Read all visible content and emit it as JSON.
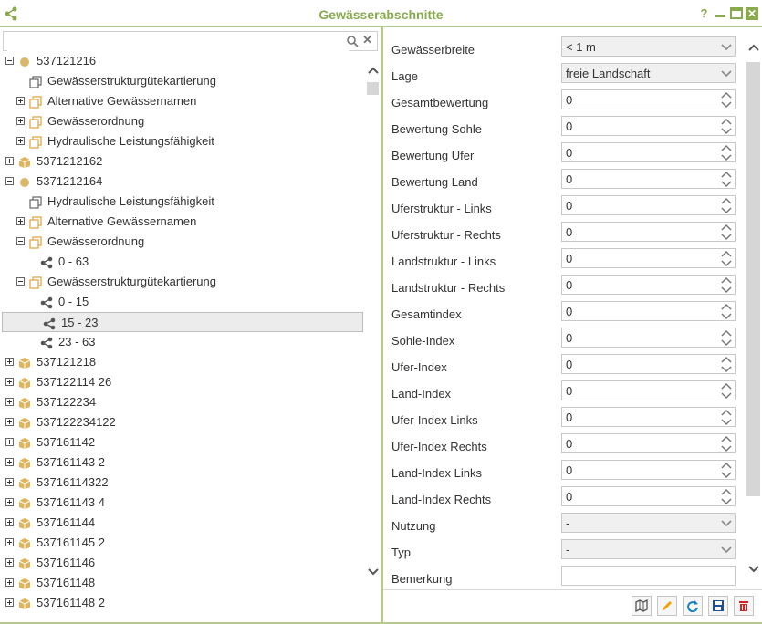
{
  "window": {
    "title": "Gewässerabschnitte",
    "help": "?",
    "accent": "#8aaa4e"
  },
  "search": {
    "value": "",
    "placeholder": ""
  },
  "tree": [
    {
      "label": "537121216",
      "depth": 0,
      "expander": "minus",
      "icon": "circle"
    },
    {
      "label": "Gewässerstrukturgütekartierung",
      "depth": 1,
      "expander": "none",
      "icon": "layers-outline"
    },
    {
      "label": "Alternative Gewässernamen",
      "depth": 1,
      "expander": "plus",
      "icon": "layers"
    },
    {
      "label": "Gewässerordnung",
      "depth": 1,
      "expander": "plus",
      "icon": "layers"
    },
    {
      "label": "Hydraulische Leistungsfähigkeit",
      "depth": 1,
      "expander": "plus",
      "icon": "layers"
    },
    {
      "label": "5371212162",
      "depth": 0,
      "expander": "plus",
      "icon": "box"
    },
    {
      "label": "5371212164",
      "depth": 0,
      "expander": "minus",
      "icon": "circle"
    },
    {
      "label": "Hydraulische Leistungsfähigkeit",
      "depth": 1,
      "expander": "none",
      "icon": "layers-outline"
    },
    {
      "label": "Alternative Gewässernamen",
      "depth": 1,
      "expander": "plus",
      "icon": "layers"
    },
    {
      "label": "Gewässerordnung",
      "depth": 1,
      "expander": "minus",
      "icon": "layers"
    },
    {
      "label": "0 - 63",
      "depth": 2,
      "expander": "none",
      "icon": "share"
    },
    {
      "label": "Gewässerstrukturgütekartierung",
      "depth": 1,
      "expander": "minus",
      "icon": "layers"
    },
    {
      "label": "0 - 15",
      "depth": 2,
      "expander": "none",
      "icon": "share"
    },
    {
      "label": "15 - 23",
      "depth": 2,
      "expander": "none",
      "icon": "share",
      "selected": true
    },
    {
      "label": "23 - 63",
      "depth": 2,
      "expander": "none",
      "icon": "share"
    },
    {
      "label": "537121218",
      "depth": 0,
      "expander": "plus",
      "icon": "box"
    },
    {
      "label": "537122114 26",
      "depth": 0,
      "expander": "plus",
      "icon": "box"
    },
    {
      "label": "537122234",
      "depth": 0,
      "expander": "plus",
      "icon": "box"
    },
    {
      "label": "537122234122",
      "depth": 0,
      "expander": "plus",
      "icon": "box"
    },
    {
      "label": "537161142",
      "depth": 0,
      "expander": "plus",
      "icon": "box"
    },
    {
      "label": "537161143 2",
      "depth": 0,
      "expander": "plus",
      "icon": "box"
    },
    {
      "label": "53716114322",
      "depth": 0,
      "expander": "plus",
      "icon": "box"
    },
    {
      "label": "537161143 4",
      "depth": 0,
      "expander": "plus",
      "icon": "box"
    },
    {
      "label": "537161144",
      "depth": 0,
      "expander": "plus",
      "icon": "box"
    },
    {
      "label": "537161145 2",
      "depth": 0,
      "expander": "plus",
      "icon": "box"
    },
    {
      "label": "537161146",
      "depth": 0,
      "expander": "plus",
      "icon": "box"
    },
    {
      "label": "537161148",
      "depth": 0,
      "expander": "plus",
      "icon": "box"
    },
    {
      "label": "537161148 2",
      "depth": 0,
      "expander": "plus",
      "icon": "box"
    }
  ],
  "form": [
    {
      "label": "Gewässerbreite",
      "type": "select",
      "value": "< 1 m"
    },
    {
      "label": "Lage",
      "type": "select",
      "value": "freie Landschaft"
    },
    {
      "label": "Gesamtbewertung",
      "type": "number",
      "value": "0"
    },
    {
      "label": "Bewertung Sohle",
      "type": "number",
      "value": "0"
    },
    {
      "label": "Bewertung Ufer",
      "type": "number",
      "value": "0"
    },
    {
      "label": "Bewertung Land",
      "type": "number",
      "value": "0"
    },
    {
      "label": "Uferstruktur - Links",
      "type": "number",
      "value": "0"
    },
    {
      "label": "Uferstruktur - Rechts",
      "type": "number",
      "value": "0"
    },
    {
      "label": "Landstruktur - Links",
      "type": "number",
      "value": "0"
    },
    {
      "label": "Landstruktur - Rechts",
      "type": "number",
      "value": "0"
    },
    {
      "label": "Gesamtindex",
      "type": "number",
      "value": "0"
    },
    {
      "label": "Sohle-Index",
      "type": "number",
      "value": "0"
    },
    {
      "label": "Ufer-Index",
      "type": "number",
      "value": "0"
    },
    {
      "label": "Land-Index",
      "type": "number",
      "value": "0"
    },
    {
      "label": "Ufer-Index Links",
      "type": "number",
      "value": "0"
    },
    {
      "label": "Ufer-Index Rechts",
      "type": "number",
      "value": "0"
    },
    {
      "label": "Land-Index Links",
      "type": "number",
      "value": "0"
    },
    {
      "label": "Land-Index Rechts",
      "type": "number",
      "value": "0"
    },
    {
      "label": "Nutzung",
      "type": "select",
      "value": "-"
    },
    {
      "label": "Typ",
      "type": "select",
      "value": "-"
    },
    {
      "label": "Bemerkung",
      "type": "text",
      "value": ""
    }
  ],
  "footer_buttons": [
    {
      "icon": "map-icon",
      "color": "#555555"
    },
    {
      "icon": "pencil-icon",
      "color": "#f0a000"
    },
    {
      "icon": "refresh-icon",
      "color": "#1a7fc1"
    },
    {
      "icon": "save-icon",
      "color": "#1a4f9a"
    },
    {
      "icon": "trash-icon",
      "color": "#d22222"
    }
  ]
}
